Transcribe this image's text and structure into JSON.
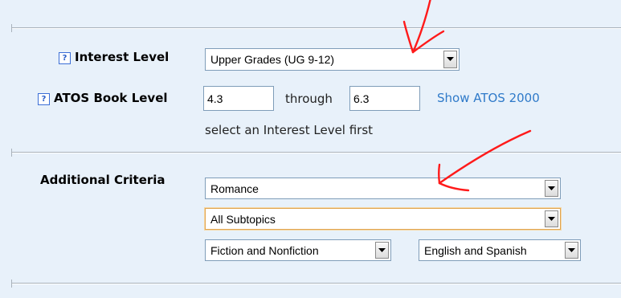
{
  "interest_level": {
    "label": "Interest Level",
    "selected": "Upper Grades (UG 9-12)"
  },
  "atos_book_level": {
    "label": "ATOS Book Level",
    "from": "4.3",
    "through_label": "through",
    "to": "6.3",
    "show_link": "Show ATOS 2000",
    "hint": "select an Interest Level first"
  },
  "additional_criteria": {
    "label": "Additional Criteria",
    "topic": "Romance",
    "subtopic": "All Subtopics",
    "fiction_filter": "Fiction and Nonfiction",
    "language_filter": "English and Spanish"
  },
  "icons": {
    "help": "?",
    "dropdown": "chevron-down-icon"
  },
  "colors": {
    "background": "#e8f1fa",
    "link": "#2f7ac9",
    "annotation": "#ff0000",
    "focus_border": "#e0a552"
  }
}
